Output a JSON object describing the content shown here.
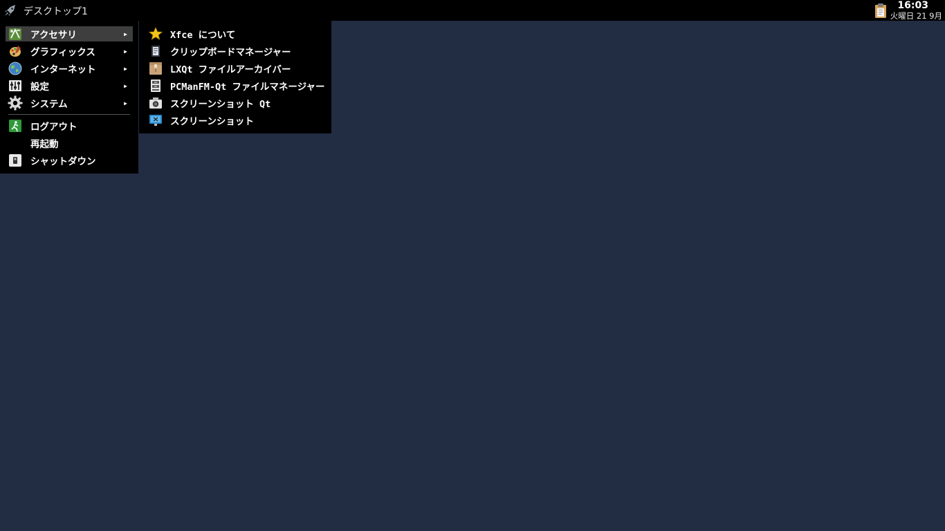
{
  "panel": {
    "desktop_name": "デスクトップ1",
    "launcher_icon": "rocket-icon",
    "tray": {
      "clipboard_icon": "clipboard-icon"
    },
    "clock": {
      "time": "16:03",
      "date": "火曜日 21 9月"
    }
  },
  "main_menu": {
    "items": [
      {
        "label": "アクセサリ",
        "icon": "accessories-icon",
        "has_submenu": true,
        "active": true
      },
      {
        "label": "グラフィックス",
        "icon": "graphics-icon",
        "has_submenu": true
      },
      {
        "label": "インターネット",
        "icon": "internet-globe-icon",
        "has_submenu": true
      },
      {
        "label": "設定",
        "icon": "settings-icon",
        "has_submenu": true
      },
      {
        "label": "システム",
        "icon": "system-gear-icon",
        "has_submenu": true
      },
      {
        "label": "ログアウト",
        "icon": "logout-icon"
      },
      {
        "label": "再起動",
        "icon": ""
      },
      {
        "label": "シャットダウン",
        "icon": "shutdown-icon"
      }
    ],
    "arrow": "▶"
  },
  "submenu_accessories": {
    "items": [
      {
        "label": "Xfce について",
        "icon": "star-icon"
      },
      {
        "label": "クリップボードマネージャー",
        "icon": "clipboard-manager-icon"
      },
      {
        "label": "LXQt ファイルアーカイバー",
        "icon": "archive-box-icon"
      },
      {
        "label": "PCManFM-Qt ファイルマネージャー",
        "icon": "file-cabinet-icon"
      },
      {
        "label": "スクリーンショット Qt",
        "icon": "camera-icon"
      },
      {
        "label": "スクリーンショット",
        "icon": "monitor-screenshot-icon"
      }
    ]
  },
  "colors": {
    "desktop_background": "#222c42",
    "panel_background": "#000000",
    "menu_background": "#000000",
    "menu_highlight": "#3e3e3e"
  }
}
